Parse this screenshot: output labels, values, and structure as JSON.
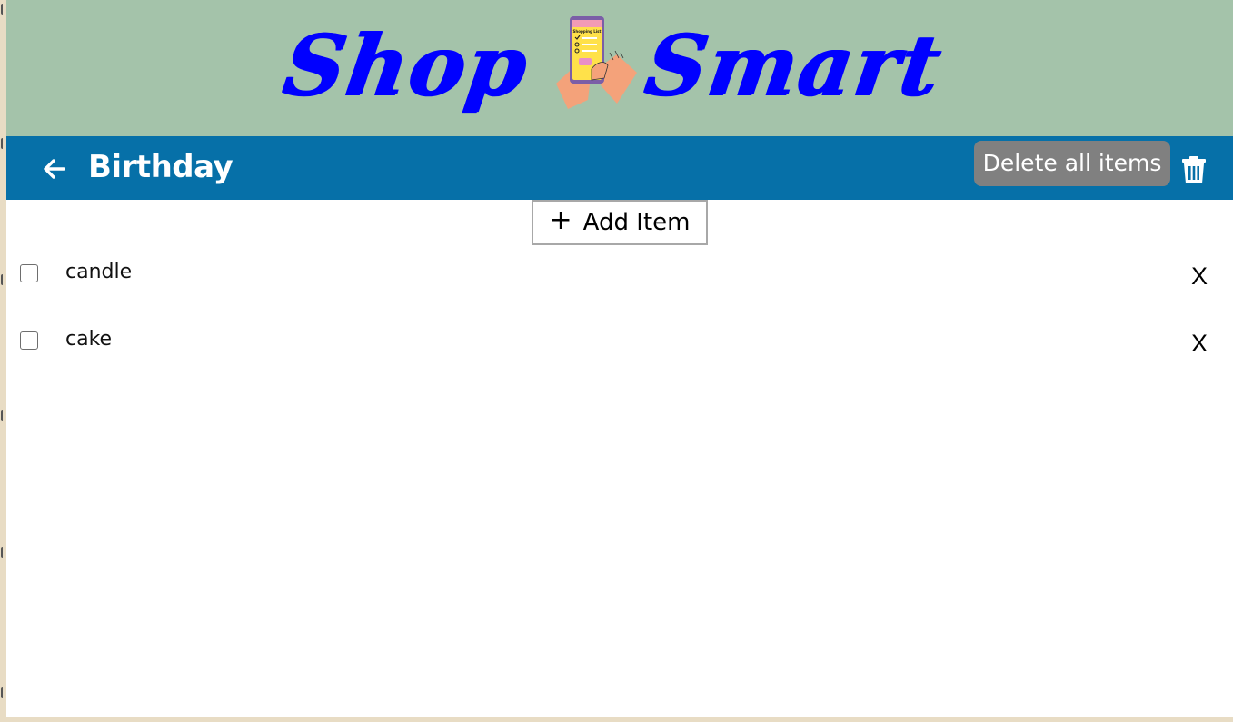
{
  "logo": {
    "word_left": "Shop",
    "word_right": "Smart",
    "phone_caption": "Shopping List"
  },
  "header": {
    "title": "Birthday",
    "delete_all_label": "Delete all items"
  },
  "add_item": {
    "icon": "+",
    "label": "Add Item"
  },
  "items": [
    {
      "label": "candle",
      "checked": false,
      "remove_label": "X"
    },
    {
      "label": "cake",
      "checked": false,
      "remove_label": "X"
    }
  ],
  "colors": {
    "hero_bg": "#a4c3aa",
    "header_bg": "#0670a8",
    "logo_text": "#0000ff",
    "delete_button_bg": "#808080",
    "page_bg": "#e8dcc4"
  },
  "icons": {
    "back": "arrow-left-icon",
    "trash": "trash-icon",
    "add": "plus-icon"
  }
}
